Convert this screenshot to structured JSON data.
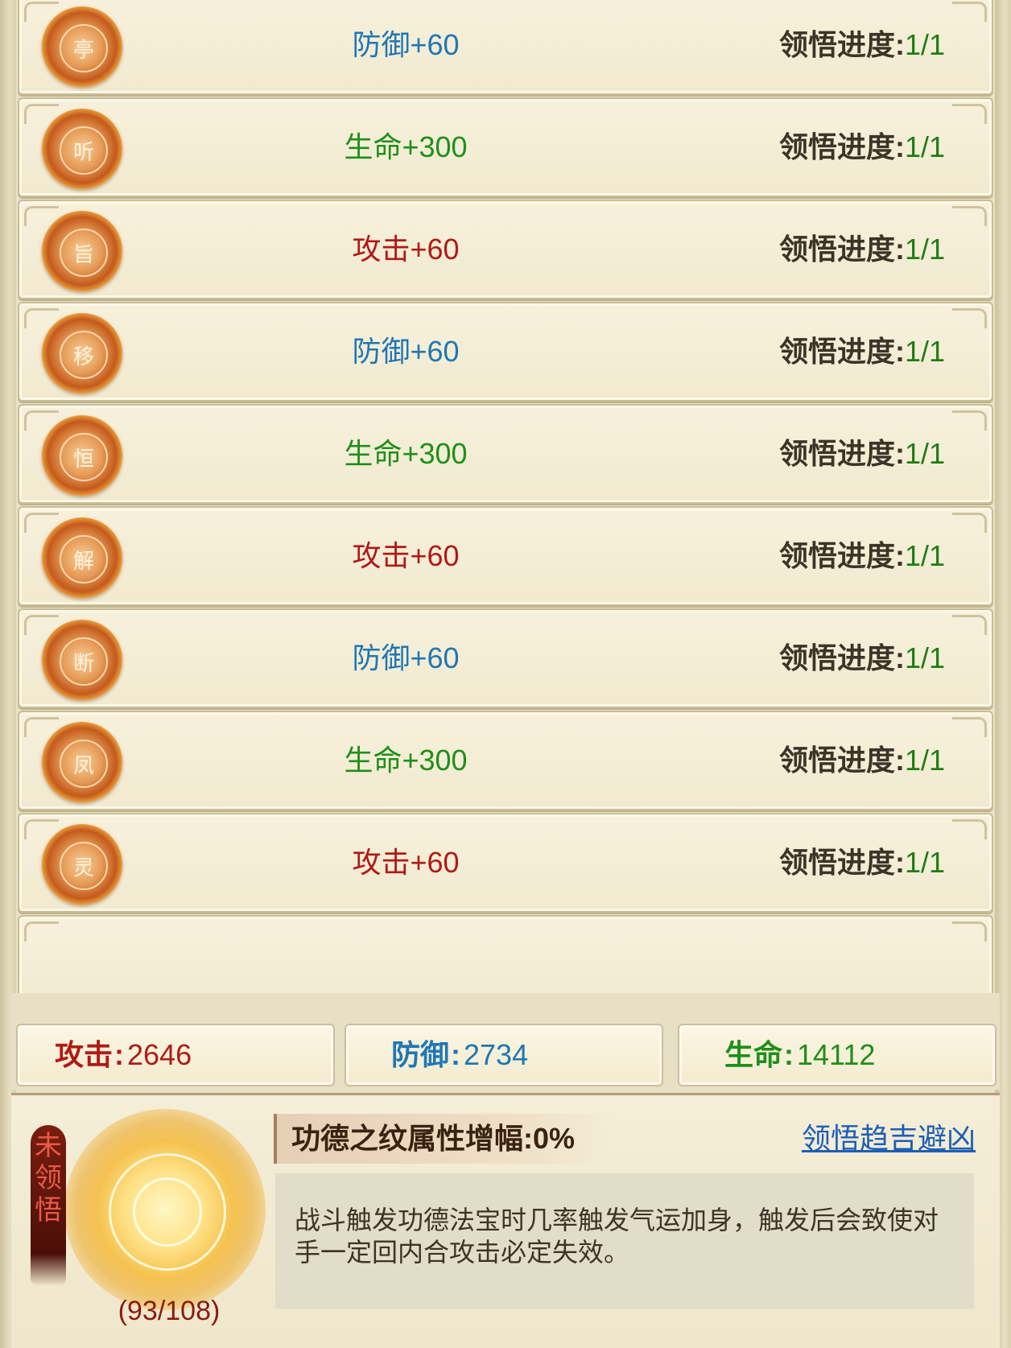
{
  "rows": [
    {
      "seal": "亭",
      "bonus": "防御+60",
      "bonus_color": "#1f77b4",
      "progress_label": "领悟进度",
      "progress_sep": ":",
      "progress_value": "1/1"
    },
    {
      "seal": "听",
      "bonus": "生命+300",
      "bonus_color": "#1f8f1a",
      "progress_label": "领悟进度",
      "progress_sep": ":",
      "progress_value": "1/1"
    },
    {
      "seal": "旨",
      "bonus": "攻击+60",
      "bonus_color": "#b01a16",
      "progress_label": "领悟进度",
      "progress_sep": ":",
      "progress_value": "1/1"
    },
    {
      "seal": "移",
      "bonus": "防御+60",
      "bonus_color": "#1f77b4",
      "progress_label": "领悟进度",
      "progress_sep": ":",
      "progress_value": "1/1"
    },
    {
      "seal": "恒",
      "bonus": "生命+300",
      "bonus_color": "#1f8f1a",
      "progress_label": "领悟进度",
      "progress_sep": ":",
      "progress_value": "1/1"
    },
    {
      "seal": "解",
      "bonus": "攻击+60",
      "bonus_color": "#b01a16",
      "progress_label": "领悟进度",
      "progress_sep": ":",
      "progress_value": "1/1"
    },
    {
      "seal": "断",
      "bonus": "防御+60",
      "bonus_color": "#1f77b4",
      "progress_label": "领悟进度",
      "progress_sep": ":",
      "progress_value": "1/1"
    },
    {
      "seal": "凤",
      "bonus": "生命+300",
      "bonus_color": "#1f8f1a",
      "progress_label": "领悟进度",
      "progress_sep": ":",
      "progress_value": "1/1"
    },
    {
      "seal": "灵",
      "bonus": "攻击+60",
      "bonus_color": "#b01a16",
      "progress_label": "领悟进度",
      "progress_sep": ":",
      "progress_value": "1/1"
    }
  ],
  "totals": {
    "attack": {
      "label": "攻击",
      "sep": ":",
      "value": "2646",
      "color": "#b01a16"
    },
    "defense": {
      "label": "防御",
      "sep": ":",
      "value": "2734",
      "color": "#1f77b4"
    },
    "life": {
      "label": "生命",
      "sep": ":",
      "value": "14112",
      "color": "#1f8f1a"
    }
  },
  "bottom": {
    "status_tag": "未领悟",
    "count": "(93/108)",
    "amplify": "功德之纹属性增幅:0%",
    "link": "领悟趋吉避凶",
    "description": "战斗触发功德法宝时几率触发气运加身，触发后会致使对手一定回内合攻击必定失效。"
  }
}
